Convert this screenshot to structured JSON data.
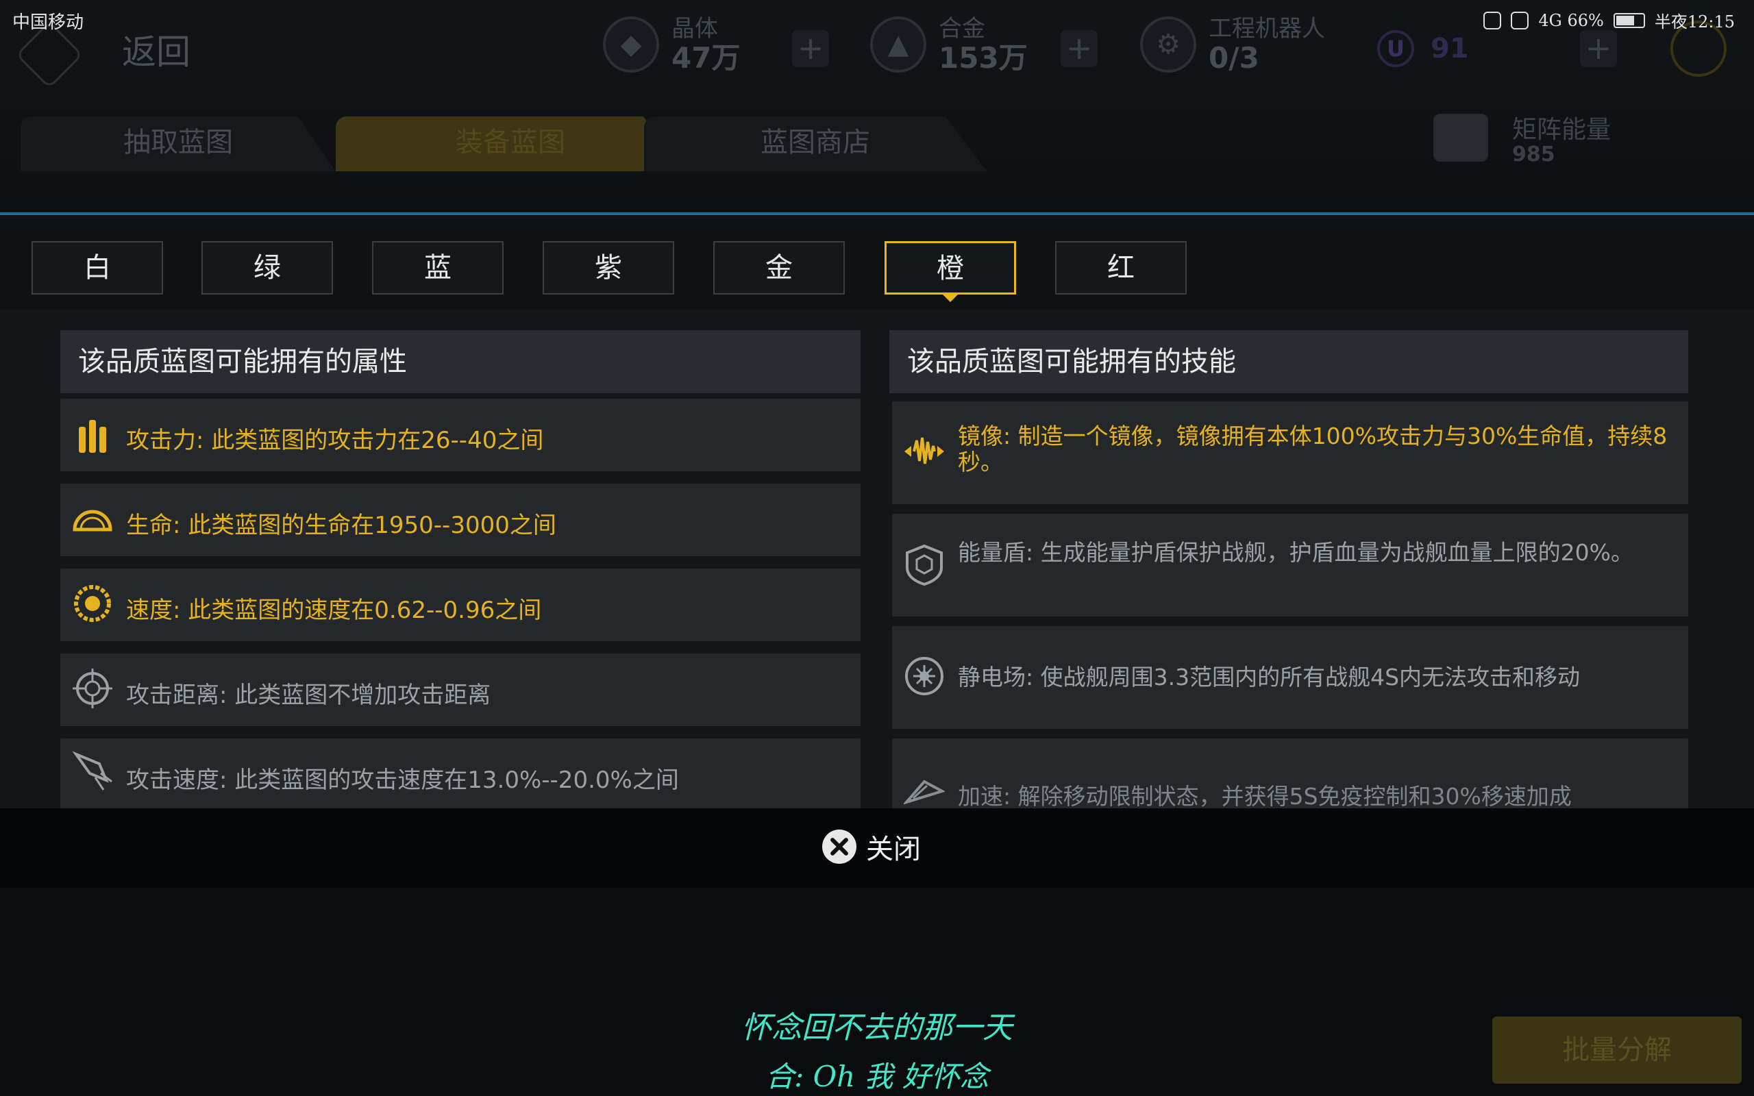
{
  "status_bar": {
    "carrier": "中国移动",
    "right_text": "4G 66%",
    "time": "半夜12:15"
  },
  "header": {
    "back_label": "返回",
    "resources": [
      {
        "name": "晶体",
        "value": "47万",
        "icon": "crystal-icon"
      },
      {
        "name": "合金",
        "value": "153万",
        "icon": "alloy-icon"
      },
      {
        "name": "工程机器人",
        "value": "0/3",
        "icon": "robot-icon"
      }
    ],
    "u_badge": "U",
    "u_value": "91"
  },
  "bg_tabs": [
    "抽取蓝图",
    "装备蓝图",
    "蓝图商店"
  ],
  "matrix": {
    "name": "矩阵能量",
    "value": "985"
  },
  "grades": [
    "白",
    "绿",
    "蓝",
    "紫",
    "金",
    "橙",
    "红"
  ],
  "selected_grade": "橙",
  "attributes": {
    "title": "该品质蓝图可能拥有的属性",
    "items": [
      {
        "icon": "bullets-icon",
        "text": "攻击力: 此类蓝图的攻击力在26--40之间",
        "active": true
      },
      {
        "icon": "shield-dome-icon",
        "text": "生命: 此类蓝图的生命在1950--3000之间",
        "active": true
      },
      {
        "icon": "speed-gear-icon",
        "text": "速度: 此类蓝图的速度在0.62--0.96之间",
        "active": true
      },
      {
        "icon": "crosshair-icon",
        "text": "攻击距离: 此类蓝图不增加攻击距离",
        "active": false
      },
      {
        "icon": "rocket-icon",
        "text": "攻击速度: 此类蓝图的攻击速度在13.0%--20.0%之间",
        "active": false
      }
    ]
  },
  "skills": {
    "title": "该品质蓝图可能拥有的技能",
    "items": [
      {
        "icon": "mirror-icon",
        "text": "镜像: 制造一个镜像，镜像拥有本体100%攻击力与30%生命值，持续8秒。",
        "active": true
      },
      {
        "icon": "hex-shield-icon",
        "text": "能量盾: 生成能量护盾保护战舰，护盾血量为战舰血量上限的20%。",
        "active": false
      },
      {
        "icon": "static-field-icon",
        "text": "静电场: 使战舰周围3.3范围内的所有战舰4S内无法攻击和移动",
        "active": false
      },
      {
        "icon": "accelerate-icon",
        "text": "加速: 解除移动限制状态，并获得5S免疫控制和30%移速加成",
        "active": false
      }
    ]
  },
  "close_label": "关闭",
  "batch_button": "批量分解",
  "lyrics": [
    "怀念回不去的那一天",
    "合: Oh 我 好怀念"
  ]
}
